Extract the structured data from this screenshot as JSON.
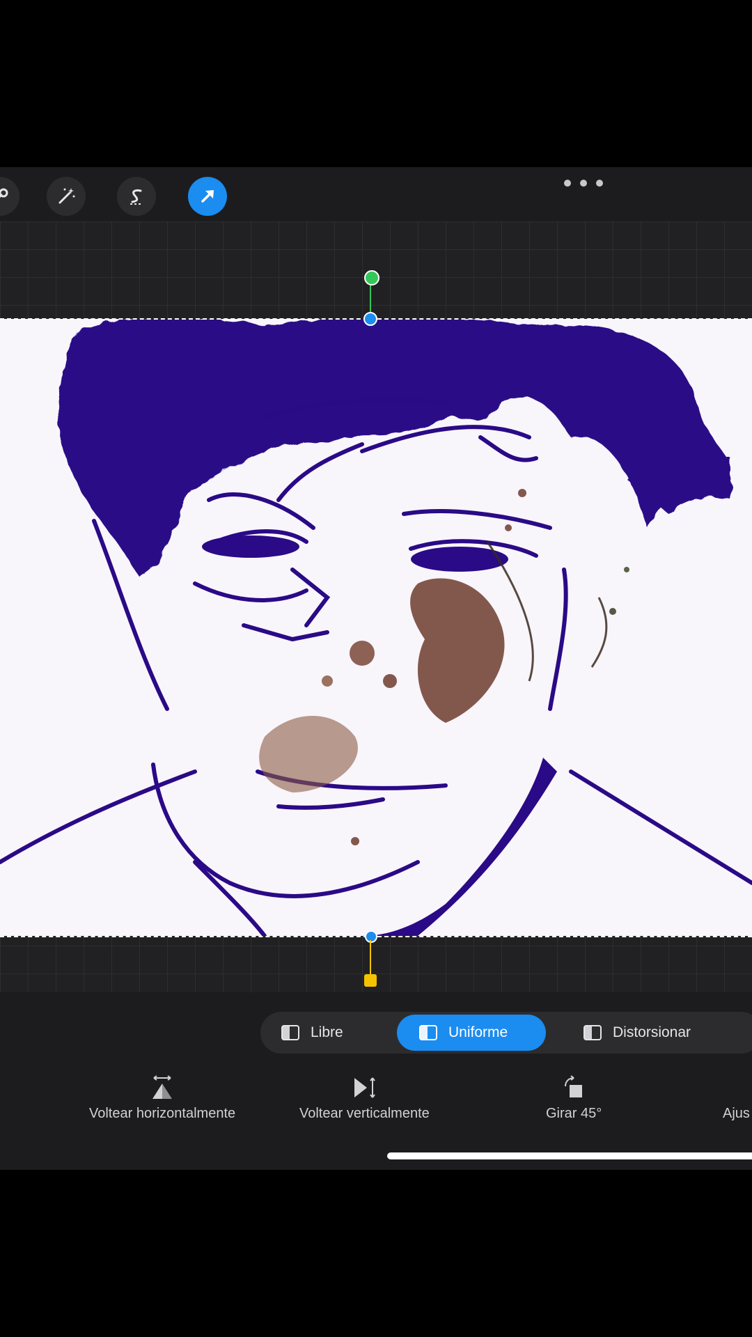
{
  "toolbar": {
    "tools": [
      {
        "icon": "wrench-icon"
      },
      {
        "icon": "magic-wand-icon"
      },
      {
        "icon": "selection-s-icon"
      },
      {
        "icon": "transform-arrow-icon",
        "active": true
      }
    ],
    "more_icon": "ellipsis-icon"
  },
  "transform_modes": {
    "items": [
      {
        "label": "Libre",
        "icon": "libre-mode-icon",
        "selected": false
      },
      {
        "label": "Uniforme",
        "icon": "uniform-mode-icon",
        "selected": true
      },
      {
        "label": "Distorsionar",
        "icon": "distort-mode-icon",
        "selected": false
      }
    ]
  },
  "actions": {
    "flip_horizontal": "Voltear horizontalmente",
    "flip_vertical": "Voltear verticalmente",
    "rotate_45": "Girar 45°",
    "fit": "Ajus"
  },
  "colors": {
    "accent": "#1b8cf0",
    "ink": "#2a0a86",
    "panel": "#1c1c1e"
  }
}
